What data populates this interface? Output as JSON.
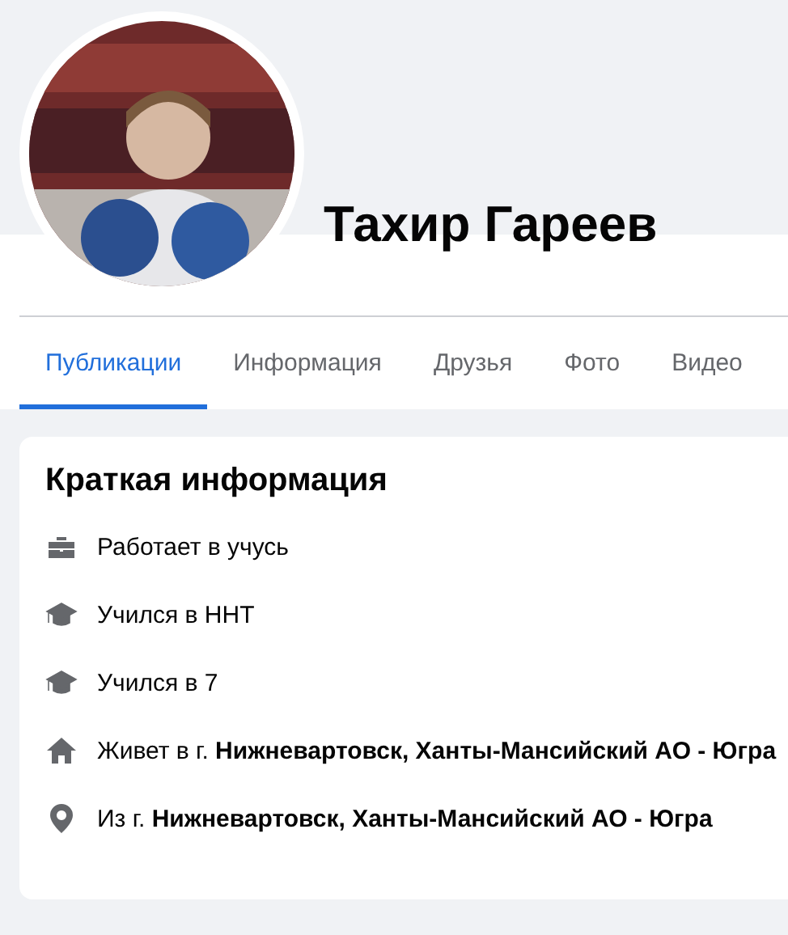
{
  "profile": {
    "name": "Тахир Гареев"
  },
  "tabs": [
    {
      "label": "Публикации",
      "selected": true
    },
    {
      "label": "Информация",
      "selected": false
    },
    {
      "label": "Друзья",
      "selected": false
    },
    {
      "label": "Фото",
      "selected": false
    },
    {
      "label": "Видео",
      "selected": false
    }
  ],
  "intro": {
    "title": "Краткая информация",
    "items": [
      {
        "kind": "work",
        "text": "Работает в учусь"
      },
      {
        "kind": "education",
        "text": "Учился в ННТ"
      },
      {
        "kind": "education",
        "text": "Учился в 7"
      },
      {
        "kind": "home",
        "text": "Живет в г. **Нижневартовск, Ханты-Мансийский АО - Югра**"
      },
      {
        "kind": "location",
        "text": "Из г. **Нижневартовск, Ханты-Мансийский АО - Югра**"
      }
    ]
  }
}
